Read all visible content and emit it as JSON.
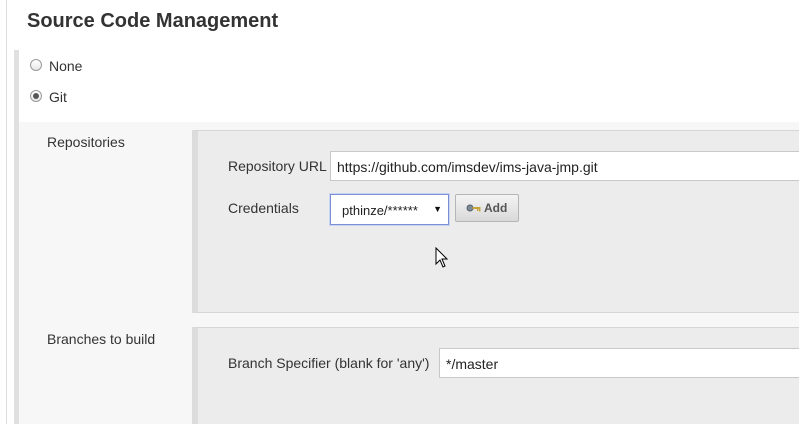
{
  "section": {
    "title": "Source Code Management"
  },
  "scm_options": [
    {
      "label": "None",
      "selected": false
    },
    {
      "label": "Git",
      "selected": true
    }
  ],
  "repositories": {
    "label": "Repositories",
    "repository_url_label": "Repository URL",
    "repository_url_value": "https://github.com/imsdev/ims-java-jmp.git",
    "credentials_label": "Credentials",
    "credentials_selected": "pthinze/******",
    "add_button_label": "Add"
  },
  "branches": {
    "label": "Branches to build",
    "branch_specifier_label": "Branch Specifier (blank for 'any')",
    "branch_specifier_value": "*/master"
  },
  "icons": {
    "add_icon": "key-icon",
    "dropdown_icon": "chevron-down-icon",
    "cursor": "mouse-pointer-icon"
  },
  "colors": {
    "panel_background": "#f7f7f7",
    "inner_box_background": "#ececec",
    "select_focus_border": "#7b8fd6"
  }
}
